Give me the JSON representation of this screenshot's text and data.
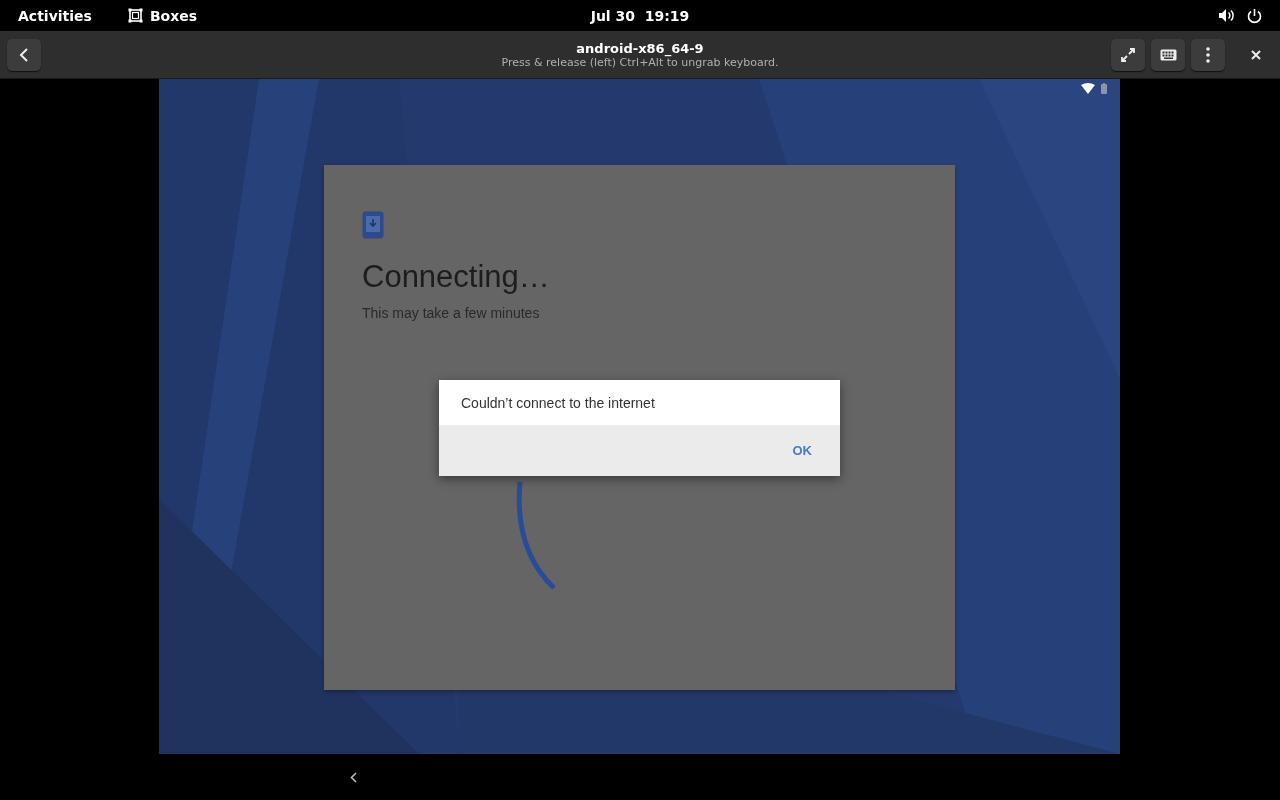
{
  "top_bar": {
    "activities": "Activities",
    "app": "Boxes",
    "clock": "Jul 30  19:19"
  },
  "header": {
    "title": "android-x86_64-9",
    "subtitle": "Press & release (left) Ctrl+Alt to ungrab keyboard."
  },
  "android": {
    "heading": "Connecting…",
    "subheading": "This may take a few minutes",
    "dialog": {
      "message": "Couldn’t connect to the internet",
      "button": "OK"
    }
  }
}
